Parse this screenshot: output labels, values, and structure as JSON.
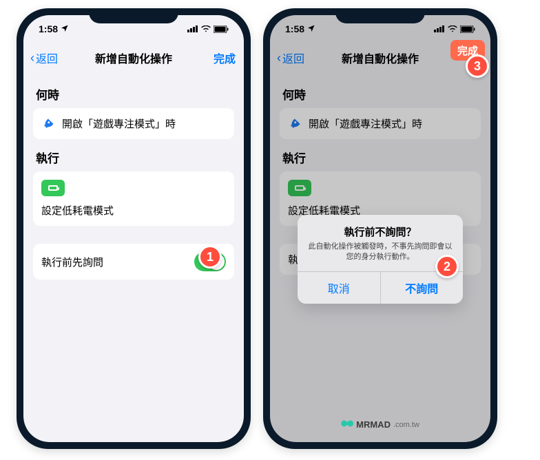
{
  "status_time": "1:58",
  "nav": {
    "back_label": "返回",
    "title": "新增自動化操作",
    "done_label": "完成"
  },
  "sections": {
    "when_header": "何時",
    "when_text": "開啟「遊戲專注模式」時",
    "exec_header": "執行",
    "exec_text": "設定低耗電模式",
    "ask_label": "執行前先詢問",
    "ask_label_short": "執行"
  },
  "alert": {
    "title": "執行前不詢問？",
    "message": "此自動化操作被觸發時，不事先詢問即會以您的身分執行動作。",
    "cancel": "取消",
    "confirm": "不詢問"
  },
  "callouts": {
    "c1": "1",
    "c2": "2",
    "c3": "3"
  },
  "watermark": {
    "brand": "MRMAD",
    "domain": ".com.tw"
  }
}
